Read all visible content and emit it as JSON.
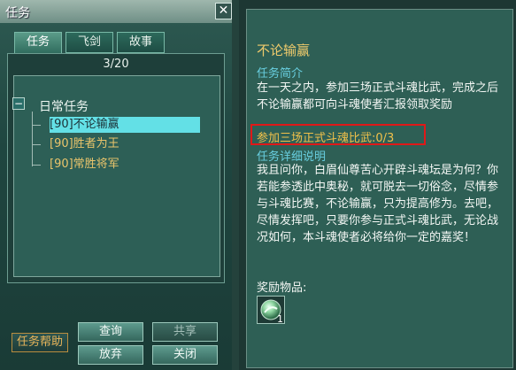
{
  "left": {
    "title": "任务",
    "close_icon": "✕",
    "tabs": [
      {
        "label": "任务",
        "active": true
      },
      {
        "label": "飞剑",
        "active": false
      },
      {
        "label": "故事",
        "active": false
      }
    ],
    "page": "3/20",
    "category": {
      "toggle": "−",
      "label": "日常任务"
    },
    "tasks": [
      {
        "label": "[90]不论输赢",
        "selected": true
      },
      {
        "label": "[90]胜者为王",
        "selected": false
      },
      {
        "label": "[90]常胜将军",
        "selected": false
      }
    ],
    "buttons": {
      "help": "任务帮助",
      "query": "查询",
      "share": "共享",
      "abandon": "放弃",
      "close": "关闭"
    }
  },
  "detail": {
    "title": "不论输赢",
    "summary_header": "任务简介",
    "summary_text": "在一天之内，参加三场正式斗魂比武，完成之后不论输赢都可向斗魂使者汇报领取奖励",
    "objective": "参加三场正式斗魂比武:0/3",
    "detail_header": "任务详细说明",
    "detail_text": "我且问你，白眉仙尊苦心开辟斗魂坛是为何？你若能参透此中奥秘，就可脱去一切俗念，尽情参与斗魂比赛，不论输赢，只为提高修为。去吧，尽情发挥吧，只要你参与正式斗魂比武，无论战况如何，本斗魂使者必将给你一定的嘉奖！",
    "reward_label": "奖励物品:",
    "reward_count": "1",
    "reward_icon": "jade-orb-icon"
  },
  "colors": {
    "highlight_box": "#e01818",
    "selected_row": "#63e0e6",
    "task_gold": "#e9c46b",
    "section_header": "#68cfe0"
  }
}
